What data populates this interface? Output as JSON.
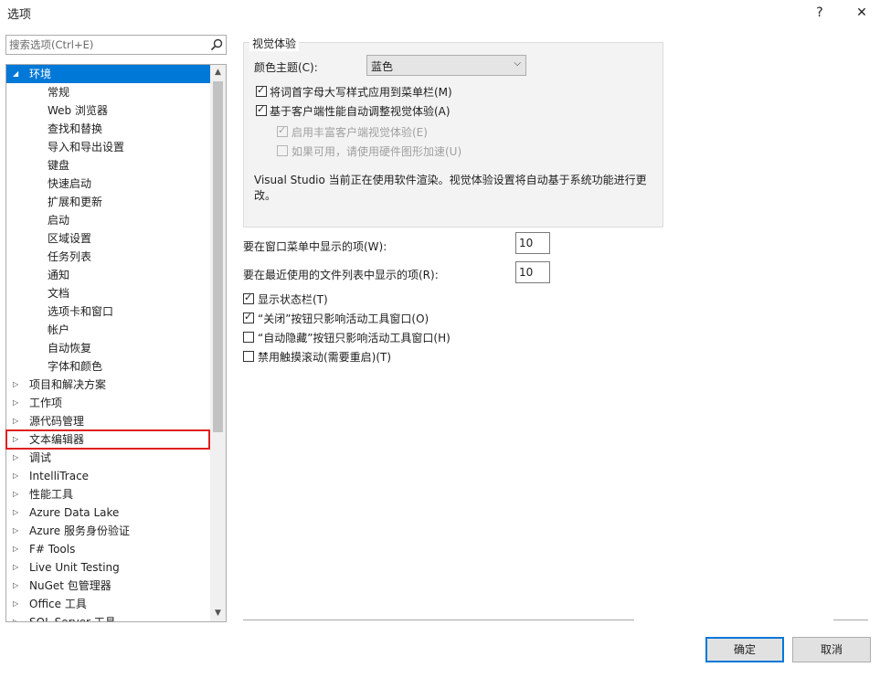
{
  "window": {
    "title": "选项",
    "help_glyph": "?",
    "close_glyph": "✕"
  },
  "search": {
    "placeholder": "搜索选项(Ctrl+E)"
  },
  "tree": {
    "items": [
      {
        "label": "环境",
        "level": 0,
        "expanded": true,
        "selected": true
      },
      {
        "label": "常规",
        "level": 1
      },
      {
        "label": "Web 浏览器",
        "level": 1
      },
      {
        "label": "查找和替换",
        "level": 1
      },
      {
        "label": "导入和导出设置",
        "level": 1
      },
      {
        "label": "键盘",
        "level": 1
      },
      {
        "label": "快速启动",
        "level": 1
      },
      {
        "label": "扩展和更新",
        "level": 1
      },
      {
        "label": "启动",
        "level": 1
      },
      {
        "label": "区域设置",
        "level": 1
      },
      {
        "label": "任务列表",
        "level": 1
      },
      {
        "label": "通知",
        "level": 1
      },
      {
        "label": "文档",
        "level": 1
      },
      {
        "label": "选项卡和窗口",
        "level": 1
      },
      {
        "label": "帐户",
        "level": 1
      },
      {
        "label": "自动恢复",
        "level": 1
      },
      {
        "label": "字体和颜色",
        "level": 1
      },
      {
        "label": "项目和解决方案",
        "level": 0
      },
      {
        "label": "工作项",
        "level": 0
      },
      {
        "label": "源代码管理",
        "level": 0
      },
      {
        "label": "文本编辑器",
        "level": 0,
        "highlighted": true
      },
      {
        "label": "调试",
        "level": 0
      },
      {
        "label": "IntelliTrace",
        "level": 0
      },
      {
        "label": "性能工具",
        "level": 0
      },
      {
        "label": "Azure Data Lake",
        "level": 0
      },
      {
        "label": "Azure 服务身份验证",
        "level": 0
      },
      {
        "label": "F# Tools",
        "level": 0
      },
      {
        "label": "Live Unit Testing",
        "level": 0
      },
      {
        "label": "NuGet 包管理器",
        "level": 0
      },
      {
        "label": "Office 工具",
        "level": 0
      },
      {
        "label": "SQL Server 工具",
        "level": 0
      }
    ],
    "expanded_glyph": "◢",
    "collapsed_glyph": "▷",
    "scroll_up_glyph": "▲",
    "scroll_down_glyph": "▼"
  },
  "visual_experience": {
    "group_title": "视觉体验",
    "color_theme_label": "颜色主题(C):",
    "color_theme_value": "蓝色",
    "chevron_glyph": "⌵",
    "cb_uppercase_menu": {
      "label": "将词首字母大写样式应用到菜单栏(M)",
      "checked": true
    },
    "cb_auto_adjust": {
      "label": "基于客户端性能自动调整视觉体验(A)",
      "checked": true
    },
    "cb_rich_client": {
      "label": "启用丰富客户端视觉体验(E)",
      "checked": true,
      "disabled": true
    },
    "cb_hardware_accel": {
      "label": "如果可用，请使用硬件图形加速(U)",
      "checked": false,
      "disabled": true
    },
    "note_line1": "Visual Studio 当前正在使用软件渲染。视觉体验设置将自动基于系统功能进行更",
    "note_line2": "改。"
  },
  "window_menu_items": {
    "label": "要在窗口菜单中显示的项(W):",
    "value": "10"
  },
  "recent_files_items": {
    "label": "要在最近使用的文件列表中显示的项(R):",
    "value": "10"
  },
  "options": {
    "status_bar": {
      "label": "显示状态栏(T)",
      "checked": true
    },
    "close_button": {
      "label": "“关闭”按钮只影响活动工具窗口(O)",
      "checked": true
    },
    "autohide_button": {
      "label": "“自动隐藏”按钮只影响活动工具窗口(H)",
      "checked": false
    },
    "touch_scroll": {
      "label": "禁用触摸滚动(需要重启)(T)",
      "checked": false
    }
  },
  "buttons": {
    "ok": "确定",
    "cancel": "取消"
  }
}
